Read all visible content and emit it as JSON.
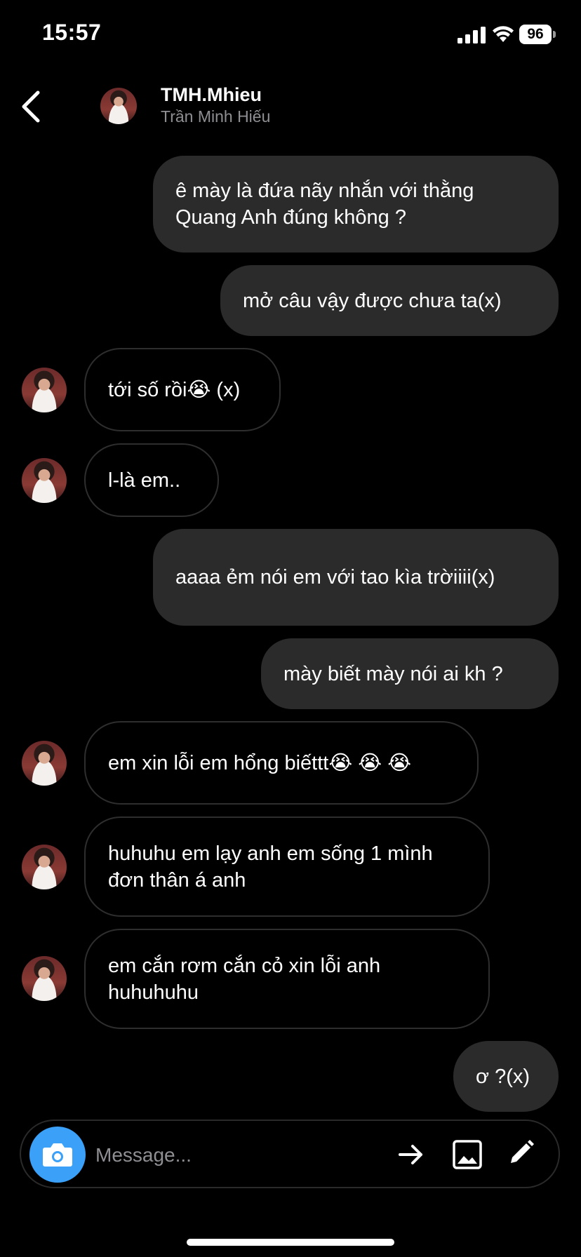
{
  "status_bar": {
    "time": "15:57",
    "battery": "96"
  },
  "header": {
    "username": "TMH.Mhieu",
    "full_name": "Trần Minh Hiếu"
  },
  "messages": [
    {
      "direction": "outgoing",
      "text": "ê mày là đứa nãy nhắn với thằng Quang Anh đúng không ?"
    },
    {
      "direction": "outgoing",
      "text": "mở câu vậy được chưa ta(x)"
    },
    {
      "direction": "incoming",
      "text": "tới số rồi😭 (x)"
    },
    {
      "direction": "incoming",
      "text": "l-là em.."
    },
    {
      "direction": "outgoing",
      "text": "aaaa ẻm nói em với tao kìa trờiiii(x)"
    },
    {
      "direction": "outgoing",
      "text": "mày biết mày nói ai kh ?"
    },
    {
      "direction": "incoming",
      "text": "em xin lỗi em hổng biếttt😭 😭 😭"
    },
    {
      "direction": "incoming",
      "text": "huhuhu em lạy anh em sống 1 mình đơn thân á anh"
    },
    {
      "direction": "incoming",
      "text": "em cắn rơm cắn cỏ xin lỗi anh huhuhuhu"
    },
    {
      "direction": "outgoing",
      "text": "ơ ?(x)"
    }
  ],
  "composer": {
    "placeholder": "Message..."
  },
  "icons": {
    "back": "chevron-left-icon",
    "camera": "camera-icon",
    "send": "arrow-right-icon",
    "gallery": "image-icon",
    "edit": "pencil-icon"
  },
  "colors": {
    "camera_button": "#3aa0f8",
    "outgoing_bubble": "#2b2b2b",
    "background": "#000000"
  }
}
